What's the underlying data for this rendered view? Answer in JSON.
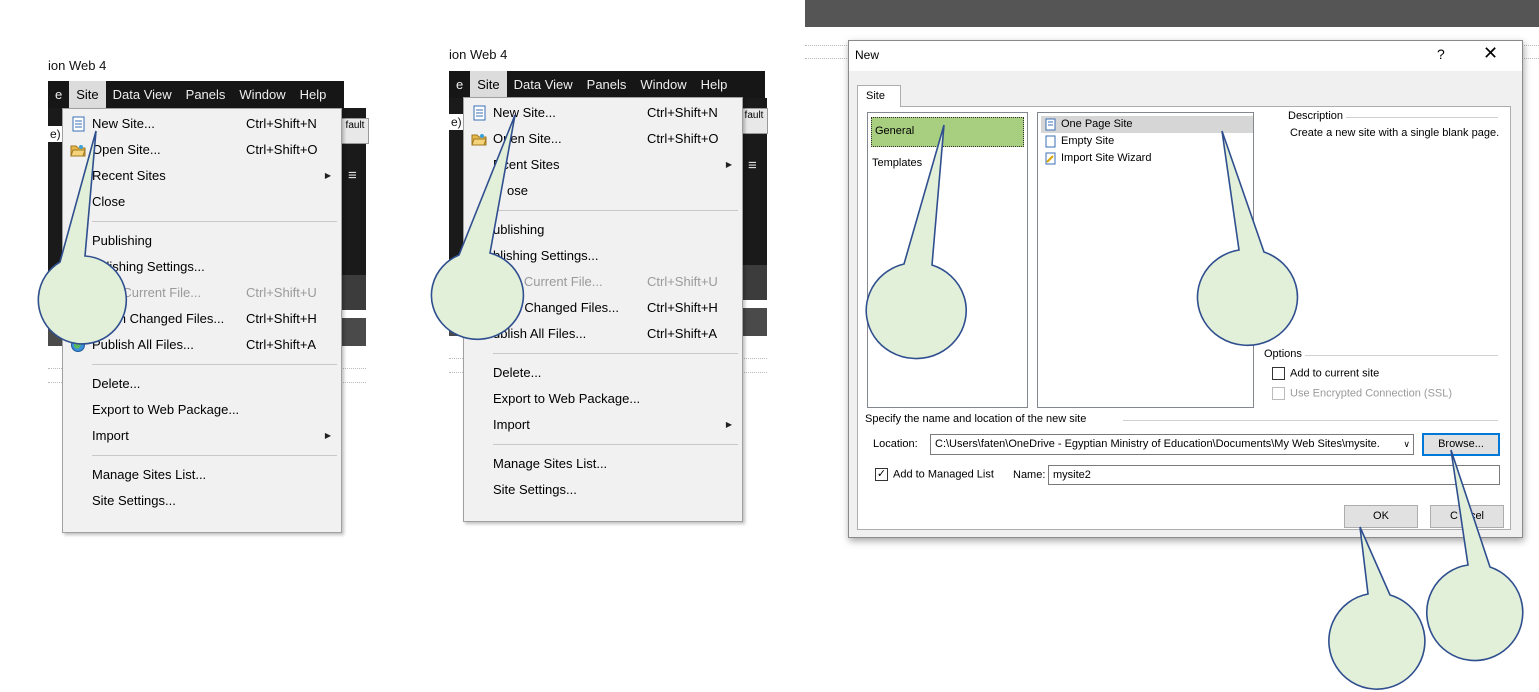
{
  "menu_panel_1": {
    "app_title": "ion Web 4",
    "menubar": [
      "e",
      "Site",
      "Data View",
      "Panels",
      "Window",
      "Help"
    ],
    "side_fragments": [
      "e)",
      "fault"
    ]
  },
  "menu_panel_2": {
    "app_title": "ion Web 4",
    "menubar": [
      "e",
      "Site",
      "Data View",
      "Panels",
      "Window",
      "Help"
    ],
    "side_fragments": [
      "e)",
      "fault"
    ],
    "covered": {
      "open_site": "Op",
      "open_site_rest": "en Site...",
      "recent_sites": "R",
      "recent_sites_rest": "cent Sites",
      "close": "ose",
      "publishing": "ublishing",
      "publishing_settings": "blishing Settings...",
      "publish_current": "h Current File...",
      "publish_changed": "sh Changed Files...",
      "publish_all": "ublish All Files..."
    }
  },
  "site_menu": {
    "new_site": {
      "label": "New Site...",
      "shortcut": "Ctrl+Shift+N",
      "icon": "new-site-icon"
    },
    "open_site": {
      "label": "Open Site...",
      "shortcut": "Ctrl+Shift+O",
      "icon": "open-folder-icon"
    },
    "recent_sites": {
      "label": "Recent Sites"
    },
    "close": {
      "label": "Close"
    },
    "publishing": {
      "label": "Publishing"
    },
    "publishing_settings": {
      "label": "Publishing Settings..."
    },
    "publish_current": {
      "label": "Publish Current File...",
      "shortcut": "Ctrl+Shift+U"
    },
    "publish_changed": {
      "label": "Publish Changed Files...",
      "shortcut": "Ctrl+Shift+H"
    },
    "publish_all": {
      "label": "Publish All Files...",
      "shortcut": "Ctrl+Shift+A",
      "icon": "globe-publish-icon"
    },
    "delete": {
      "label": "Delete..."
    },
    "export": {
      "label": "Export to Web Package..."
    },
    "import": {
      "label": "Import"
    },
    "manage_sites": {
      "label": "Manage Sites List..."
    },
    "site_settings": {
      "label": "Site Settings..."
    },
    "panel1_covered": {
      "new_site_rest": "ew Site...",
      "open_site_rest": "pen Site...",
      "publishing_settings": "ublishing Settings...",
      "publish_current": "blish Current File...",
      "publish_changed": "ublish Changed Files..."
    }
  },
  "dialog": {
    "title": "New",
    "help": "?",
    "close": "✕",
    "tab": "Site",
    "categories": [
      "General",
      "Templates"
    ],
    "site_types": [
      "One Page Site",
      "Empty Site",
      "Import Site Wizard"
    ],
    "description_label": "Description",
    "description_text": "Create a new site with a single blank page.",
    "options_label": "Options",
    "add_to_current": "Add to current site",
    "use_ssl": "Use Encrypted Connection (SSL)",
    "specify_label": "Specify the name and location of the new site",
    "location_label": "Location:",
    "location_value": "C:\\Users\\faten\\OneDrive - Egyptian Ministry of Education\\Documents\\My Web Sites\\mysite.",
    "browse": "Browse...",
    "add_managed": "Add to Managed List",
    "add_managed_checked": "✓",
    "name_label": "Name:",
    "name_value": "mysite2",
    "ok": "OK",
    "cancel_left": "C",
    "cancel_right": "cel"
  },
  "colors": {
    "callout_fill": "#e2efd9",
    "callout_stroke": "#2f4f8f",
    "selected_category": "#a8cf80"
  }
}
